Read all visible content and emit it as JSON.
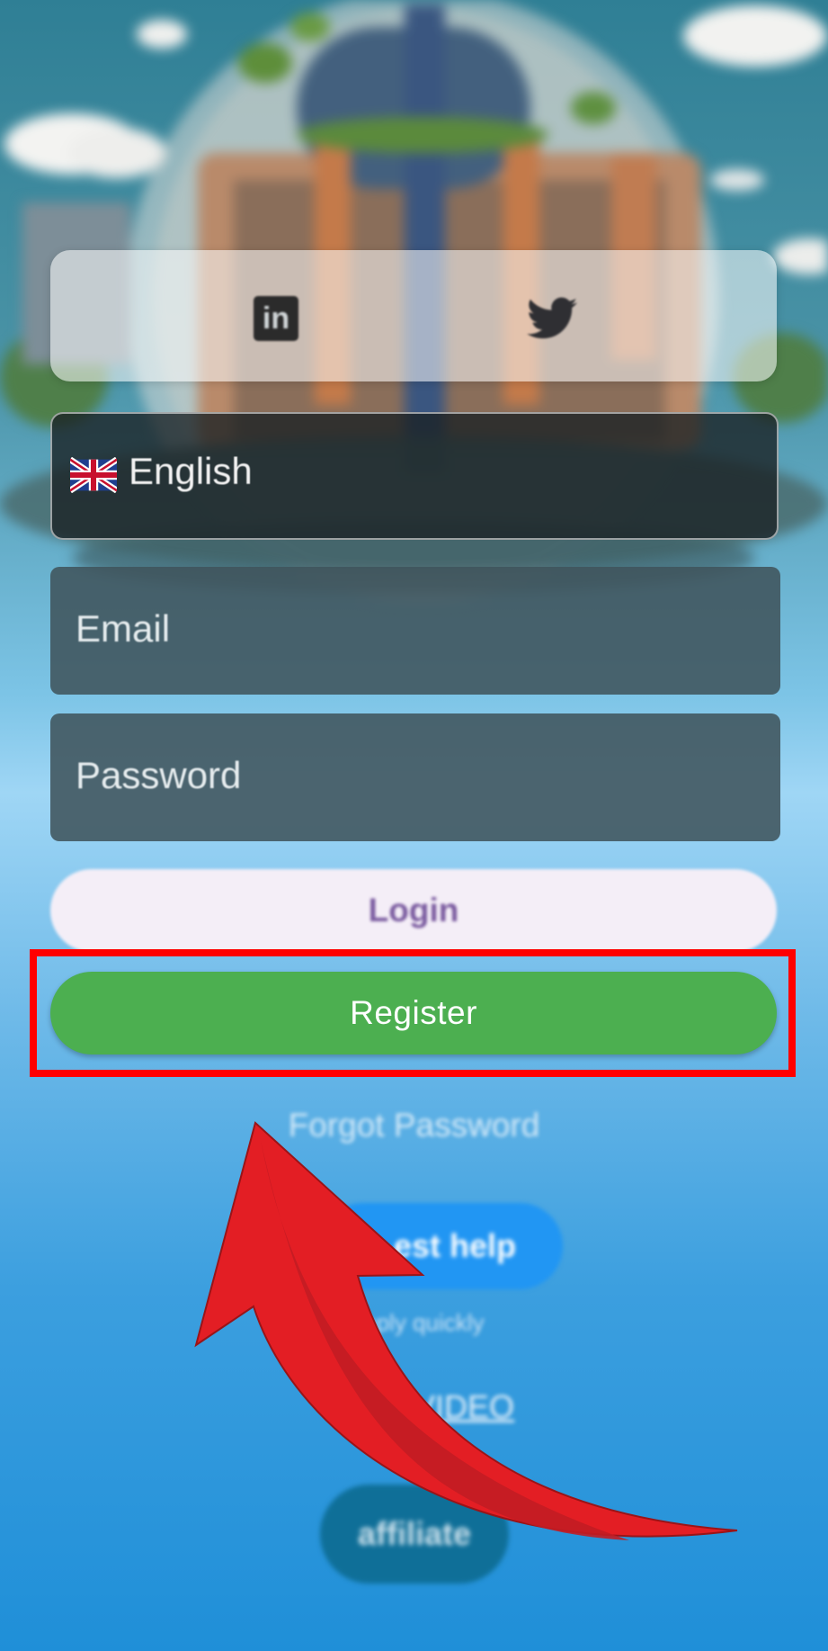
{
  "social": {
    "linkedin_icon": "linkedin-icon",
    "twitter_icon": "twitter-icon"
  },
  "language": {
    "flag_icon": "uk-flag-icon",
    "value": "English"
  },
  "email": {
    "placeholder": "Email"
  },
  "password": {
    "placeholder": "Password"
  },
  "buttons": {
    "login_label": "Login",
    "register_label": "Register",
    "help_label": "est help",
    "affiliate_label": "affiliate"
  },
  "links": {
    "forgot_password": "Forgot Password",
    "reply_note": "l reply quickly",
    "video": "VIDEO"
  },
  "annotation": {
    "highlight_color": "#ff0000",
    "arrow_color": "#e31e24"
  },
  "colors": {
    "register": "#4caf50",
    "help": "#2196f3"
  }
}
